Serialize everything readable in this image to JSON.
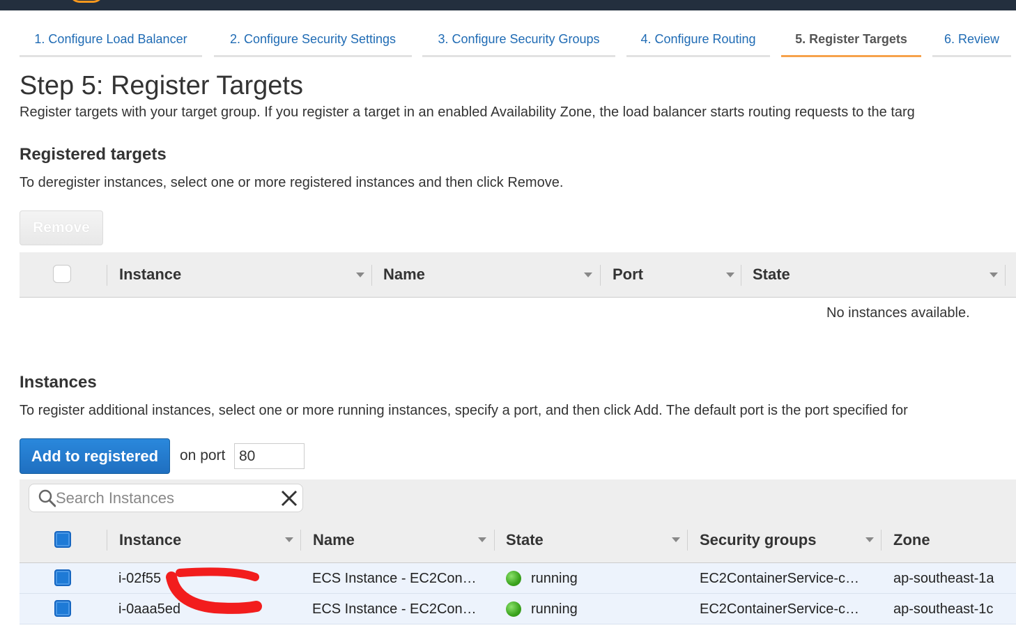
{
  "steps": [
    {
      "label": "1. Configure Load Balancer"
    },
    {
      "label": "2. Configure Security Settings"
    },
    {
      "label": "3. Configure Security Groups"
    },
    {
      "label": "4. Configure Routing"
    },
    {
      "label": "5. Register Targets"
    },
    {
      "label": "6. Review"
    }
  ],
  "page": {
    "title": "Step 5: Register Targets",
    "description": "Register targets with your target group. If you register a target in an enabled Availability Zone, the load balancer starts routing requests to the targ"
  },
  "registered": {
    "title": "Registered targets",
    "description": "To deregister instances, select one or more registered instances and then click Remove.",
    "remove_label": "Remove",
    "columns": [
      "Instance",
      "Name",
      "Port",
      "State"
    ],
    "empty_message": "No instances available."
  },
  "instances": {
    "title": "Instances",
    "description": "To register additional instances, select one or more running instances, specify a port, and then click Add. The default port is the port specified for",
    "add_label": "Add to registered",
    "on_port_label": "on port",
    "port_value": "80",
    "search_placeholder": "Search Instances",
    "columns": [
      "Instance",
      "Name",
      "State",
      "Security groups",
      "Zone"
    ],
    "rows": [
      {
        "instance": "i-02f55",
        "name": "ECS Instance - EC2Con…",
        "state": "running",
        "security_group": "EC2ContainerService-c…",
        "zone": "ap-southeast-1a"
      },
      {
        "instance": "i-0aaa5ed",
        "name": "ECS Instance - EC2Con…",
        "state": "running",
        "security_group": "EC2ContainerService-c…",
        "zone": "ap-southeast-1c"
      }
    ]
  },
  "colors": {
    "link": "#1f6bb4",
    "active_tab_underline": "#f6a24b",
    "primary_button": "#1f6fc0",
    "topbar": "#232f3e",
    "running": "#3aa31d"
  }
}
